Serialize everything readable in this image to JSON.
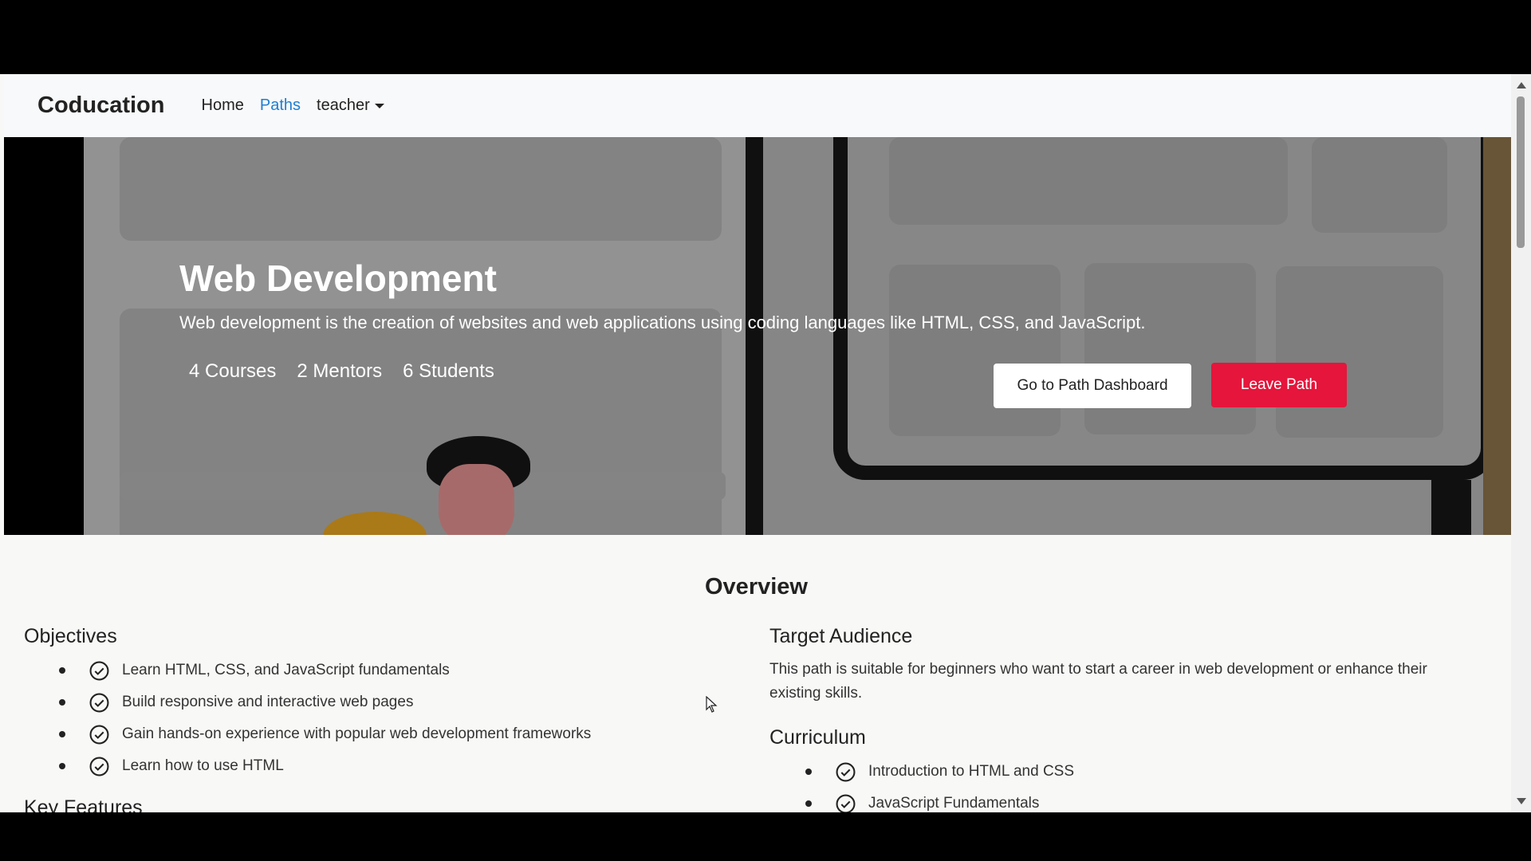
{
  "navbar": {
    "brand": "Coducation",
    "links": [
      "Home",
      "Paths"
    ],
    "user_menu": "teacher"
  },
  "hero": {
    "title": "Web Development",
    "description": "Web development is the creation of websites and web applications using coding languages like HTML, CSS, and JavaScript.",
    "stats": [
      "4 Courses",
      "2 Mentors",
      "6 Students"
    ],
    "dashboard_button": "Go to Path Dashboard",
    "leave_button": "Leave Path"
  },
  "overview": {
    "title": "Overview",
    "objectives": {
      "heading": "Objectives",
      "items": [
        "Learn HTML, CSS, and JavaScript fundamentals",
        "Build responsive and interactive web pages",
        "Gain hands-on experience with popular web development frameworks",
        "Learn how to use HTML"
      ]
    },
    "key_features_heading": "Key Features",
    "target_audience": {
      "heading": "Target Audience",
      "text_line1": "This path is suitable for beginners who want to start a career in web development or enhance their",
      "text_line2": "existing skills."
    },
    "curriculum": {
      "heading": "Curriculum",
      "items": [
        "Introduction to HTML and CSS",
        "JavaScript Fundamentals"
      ]
    }
  },
  "colors": {
    "active_link": "#1f7fd1",
    "leave_button": "#e5153b",
    "hero_background": "#8e8e8e"
  }
}
